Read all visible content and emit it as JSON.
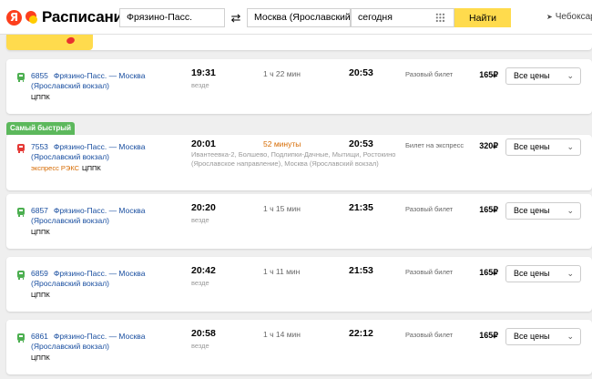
{
  "header": {
    "logo_ya": "Я",
    "logo_text": "Расписания",
    "from_value": "Фрязино-Пасс.",
    "swap_icon": "⇄",
    "to_value": "Москва (Ярославский в",
    "date_value": "сегодня",
    "find_label": "Найти",
    "geo_icon": "➤",
    "geo_text": "Чебоксар"
  },
  "fast_badge": "Самый быстрый",
  "trips": [
    {
      "number": "6855",
      "route": "Фрязино-Пасс. — Москва (Ярославский вокзал)",
      "express": "",
      "carrier": "ЦППК",
      "departure": "19:31",
      "stops": "везде",
      "duration": "1 ч 22 мин",
      "arrival": "20:53",
      "ticket": "Разовый билет",
      "price": "165₽",
      "select_label": "Все цены",
      "icon": "train-icon",
      "color": "#4caf50"
    },
    {
      "number": "7553",
      "route": "Фрязино-Пасс. — Москва (Ярославский вокзал)",
      "express": "экспресс РЭКС",
      "carrier": "ЦППК",
      "departure": "20:01",
      "stops": "Ивантеевка-2, Болшево, Подлипки-Дачные, Мытищи, Ростокино (Ярославское направление), Москва (Ярославский вокзал)",
      "duration": "52 минуты",
      "arrival": "20:53",
      "ticket": "Билет на экспресс",
      "price": "320₽",
      "select_label": "Все цены",
      "icon": "train-icon",
      "color": "#e53935"
    },
    {
      "number": "6857",
      "route": "Фрязино-Пасс. — Москва (Ярославский вокзал)",
      "express": "",
      "carrier": "ЦППК",
      "departure": "20:20",
      "stops": "везде",
      "duration": "1 ч 15 мин",
      "arrival": "21:35",
      "ticket": "Разовый билет",
      "price": "165₽",
      "select_label": "Все цены",
      "icon": "train-icon",
      "color": "#4caf50"
    },
    {
      "number": "6859",
      "route": "Фрязино-Пасс. — Москва (Ярославский вокзал)",
      "express": "",
      "carrier": "ЦППК",
      "departure": "20:42",
      "stops": "везде",
      "duration": "1 ч 11 мин",
      "arrival": "21:53",
      "ticket": "Разовый билет",
      "price": "165₽",
      "select_label": "Все цены",
      "icon": "train-icon",
      "color": "#4caf50"
    },
    {
      "number": "6861",
      "route": "Фрязино-Пасс. — Москва (Ярославский вокзал)",
      "express": "",
      "carrier": "ЦППК",
      "departure": "20:58",
      "stops": "везде",
      "duration": "1 ч 14 мин",
      "arrival": "22:12",
      "ticket": "Разовый билет",
      "price": "165₽",
      "select_label": "Все цены",
      "icon": "train-icon",
      "color": "#4caf50"
    }
  ],
  "select_chevron": "⌄"
}
